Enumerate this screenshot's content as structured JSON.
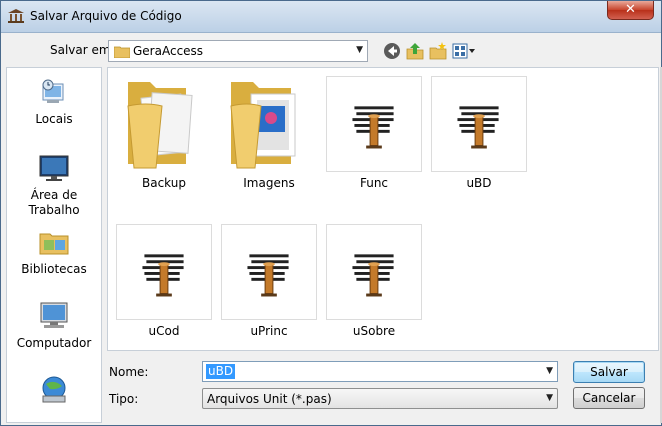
{
  "window": {
    "title": "Salvar Arquivo de Código",
    "close_label": "✕"
  },
  "toolbar": {
    "save_in_label": "Salvar em:",
    "current_folder": "GeraAccess",
    "icons": [
      "back-icon",
      "up-folder-icon",
      "new-folder-icon",
      "view-menu-icon"
    ]
  },
  "places": [
    {
      "label": "Locais",
      "icon": "recent-places-icon"
    },
    {
      "label": "Área de Trabalho",
      "icon": "desktop-icon"
    },
    {
      "label": "Bibliotecas",
      "icon": "libraries-icon"
    },
    {
      "label": "Computador",
      "icon": "computer-icon"
    },
    {
      "label": "",
      "icon": "network-icon"
    }
  ],
  "files": [
    {
      "label": "Backup",
      "kind": "folder"
    },
    {
      "label": "Imagens",
      "kind": "folder-pictures"
    },
    {
      "label": "Func",
      "kind": "delphi-unit"
    },
    {
      "label": "uBD",
      "kind": "delphi-unit"
    },
    {
      "label": "uCod",
      "kind": "delphi-unit"
    },
    {
      "label": "uPrinc",
      "kind": "delphi-unit"
    },
    {
      "label": "uSobre",
      "kind": "delphi-unit"
    }
  ],
  "form": {
    "name_label": "Nome:",
    "name_value": "uBD",
    "type_label": "Tipo:",
    "type_value": "Arquivos Unit (*.pas)"
  },
  "buttons": {
    "save": "Salvar",
    "cancel": "Cancelar"
  }
}
